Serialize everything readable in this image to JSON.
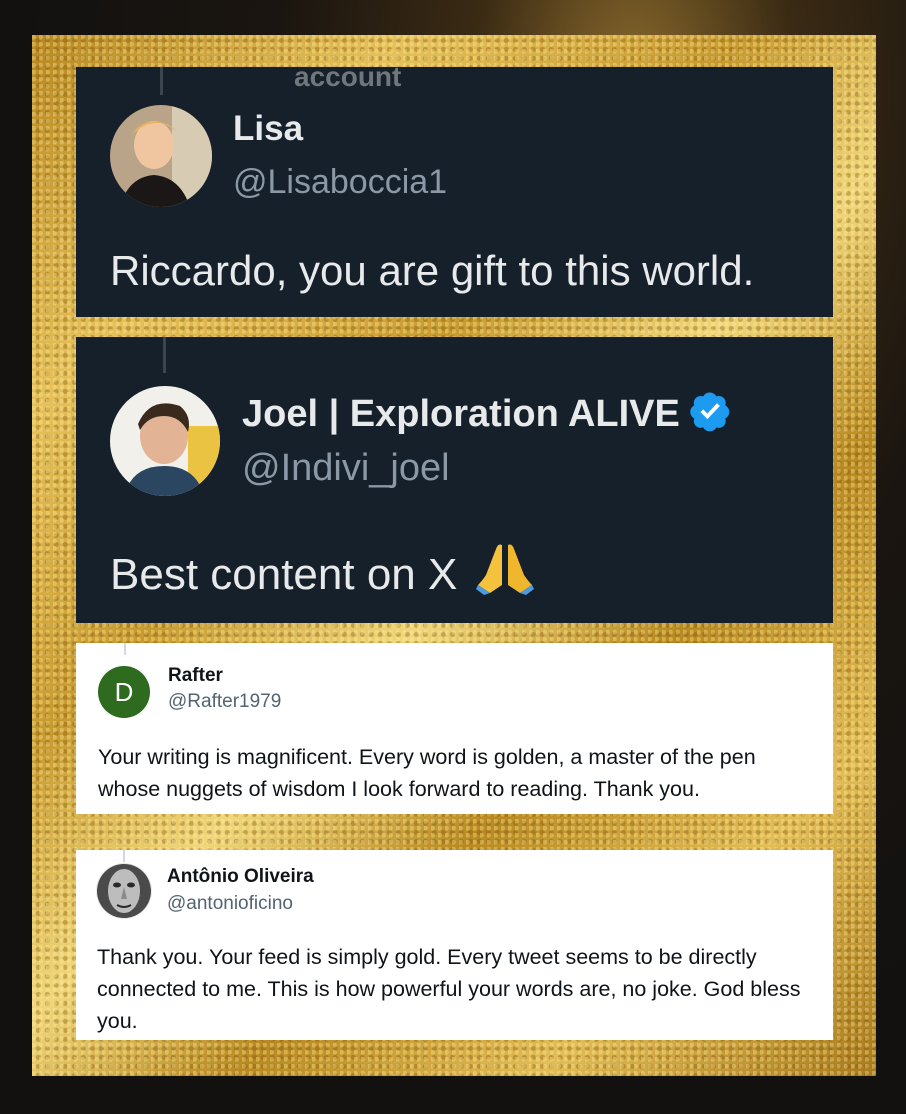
{
  "cards": [
    {
      "overflow_text": "account",
      "name": "Lisa",
      "handle": "@Lisaboccia1",
      "text": "Riccardo, you are gift to this world."
    },
    {
      "name": "Joel | Exploration ALIVE",
      "handle": "@Indivi_joel",
      "text": "Best content on X",
      "emoji": "🙏",
      "verified": true
    },
    {
      "avatar_letter": "D",
      "name": "Rafter",
      "handle": "@Rafter1979",
      "text": "Your writing is magnificent. Every word is golden, a master of the pen whose nuggets of wisdom I look forward to reading. Thank you.",
      "avatar_color": "#2e6b1f"
    },
    {
      "name": "Antônio Oliveira",
      "handle": "@antonioficino",
      "text": "Thank you. Your feed is simply gold. Every tweet seems to be directly connected to me. This is how powerful your words are, no joke. God bless you."
    }
  ],
  "colors": {
    "dark_bg": "#15202b",
    "verified": "#1d9bf0",
    "gold": "#d4a93a"
  }
}
